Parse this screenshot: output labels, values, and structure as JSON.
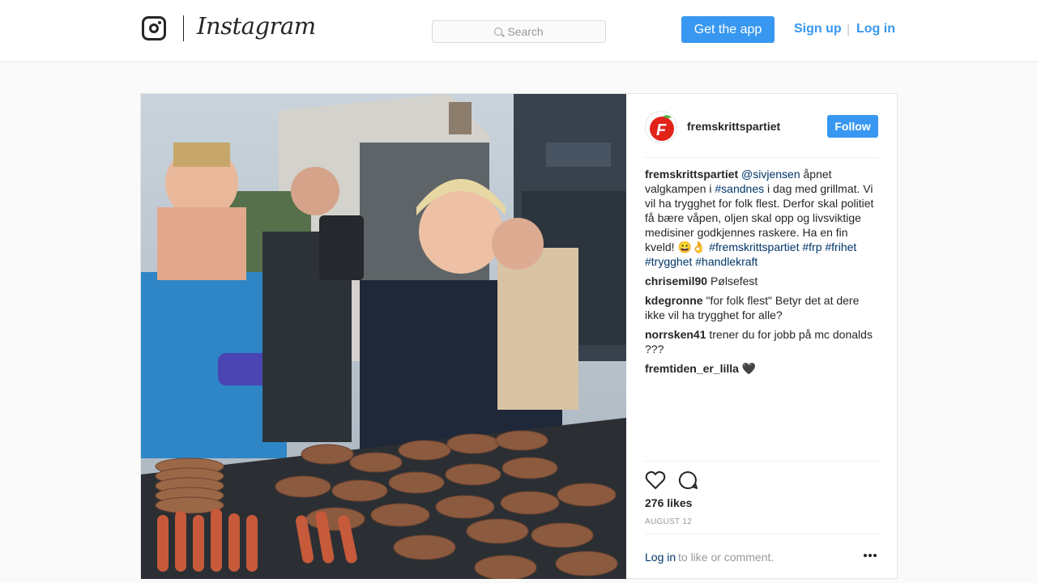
{
  "header": {
    "wordmark": "Instagram",
    "search_placeholder": "Search",
    "get_app_label": "Get the app",
    "signup_label": "Sign up",
    "separator": "|",
    "login_label": "Log in"
  },
  "post": {
    "author": "fremskrittspartiet",
    "follow_label": "Follow",
    "caption": {
      "user": "fremskrittspartiet",
      "mention": "@sivjensen",
      "text1": " åpnet valgkampen i ",
      "tag_sandnes": "#sandnes",
      "text2": " i dag med grillmat. Vi vil ha trygghet for folk flest. Derfor skal politiet få bære våpen, oljen skal opp og livsviktige medisiner godkjennes raskere. Ha en fin kveld! 😀👌 ",
      "tag1": "#fremskrittspartiet",
      "tag2": "#frp",
      "tag3": "#frihet",
      "tag4": "#trygghet",
      "tag5": "#handlekraft"
    },
    "comments": [
      {
        "user": "chrisemil90",
        "text": "Pølsefest"
      },
      {
        "user": "kdegronne",
        "text": "\"for folk flest\" Betyr det at dere ikke vil ha trygghet for alle?"
      },
      {
        "user": "norrsken41",
        "text": "trener du for jobb på mc donalds ???"
      },
      {
        "user": "fremtiden_er_lilla",
        "text": "🖤"
      }
    ],
    "likes": "276 likes",
    "date": "AUGUST 12",
    "footer_login": "Log in",
    "footer_text": "to like or comment."
  },
  "icons": {
    "logo": "instagram-camera-icon",
    "search": "search-icon",
    "like": "heart-icon",
    "comment": "speech-bubble-icon",
    "more": "more-options-icon"
  },
  "colors": {
    "accent": "#3897f0",
    "link": "#003569",
    "text": "#262626",
    "muted": "#999999",
    "brand_red": "#e2231a"
  }
}
